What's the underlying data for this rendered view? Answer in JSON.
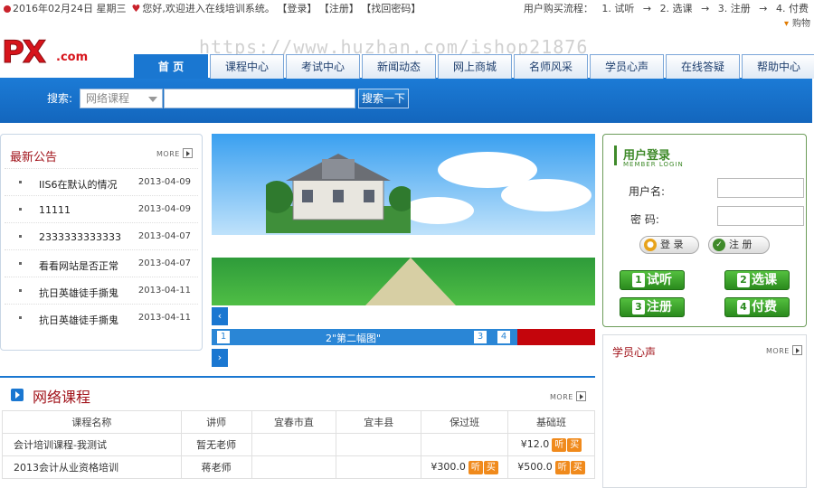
{
  "top": {
    "date": "2016年02月24日 星期三",
    "welcome": "您好,欢迎进入在线培训系统。",
    "links": [
      "【登录】",
      "【注册】",
      "【找回密码】"
    ],
    "flow_label": "用户购买流程：",
    "flow_steps": [
      "1. 试听",
      "2. 选课",
      "3. 注册",
      "4. 付费"
    ],
    "cart": "购物"
  },
  "logo": {
    "main": "PX",
    "suffix": ".com"
  },
  "watermark": "https://www.huzhan.com/ishop21876",
  "nav": [
    "首 页",
    "课程中心",
    "考试中心",
    "新闻动态",
    "网上商城",
    "名师风采",
    "学员心声",
    "在线答疑",
    "帮助中心"
  ],
  "search": {
    "label": "搜索:",
    "select_value": "网络课程",
    "button": "搜索一下"
  },
  "news": {
    "title": "最新公告",
    "more": "MORE",
    "items": [
      {
        "title": "IIS6在默认的情况",
        "date": "2013-04-09"
      },
      {
        "title": "11111",
        "date": "2013-04-09"
      },
      {
        "title": "2333333333333",
        "date": "2013-04-07"
      },
      {
        "title": "看看网站是否正常",
        "date": "2013-04-07"
      },
      {
        "title": "抗日英雄徒手撕鬼",
        "date": "2013-04-11"
      },
      {
        "title": "抗日英雄徒手撕鬼",
        "date": "2013-04-11"
      }
    ]
  },
  "slider": {
    "caption": "2\"第二幅图\"",
    "numbers": [
      "1",
      "3",
      "4"
    ],
    "prev": "‹",
    "next": "›"
  },
  "login": {
    "title": "用户登录",
    "subtitle": "MEMBER LOGIN",
    "username_label": "用户名:",
    "password_label": "密 码:",
    "login_btn": "登 录",
    "register_btn": "注 册",
    "steps": [
      {
        "n": "1",
        "label": "试听"
      },
      {
        "n": "2",
        "label": "选课"
      },
      {
        "n": "3",
        "label": "注册"
      },
      {
        "n": "4",
        "label": "付费"
      }
    ]
  },
  "testimonials": {
    "title": "学员心声",
    "more": "MORE"
  },
  "courses": {
    "title": "网络课程",
    "more": "MORE",
    "headers": [
      "课程名称",
      "讲师",
      "宜春市直",
      "宜丰县",
      "保过班",
      "基础班"
    ],
    "rows": [
      {
        "name": "会计培训课程-我测试",
        "teacher": "暂无老师",
        "c1": "",
        "c2": "",
        "c3": "",
        "c4": "¥12.0"
      },
      {
        "name": "2013会计从业资格培训",
        "teacher": "蒋老师",
        "c1": "",
        "c2": "",
        "c3": "¥300.0",
        "c4": "¥500.0"
      }
    ],
    "listen": "听",
    "buy": "买"
  },
  "colors": {
    "brand_red": "#d7141b",
    "nav_blue": "#1a77d1",
    "green": "#3f8a2a",
    "orange": "#f08a1c"
  }
}
